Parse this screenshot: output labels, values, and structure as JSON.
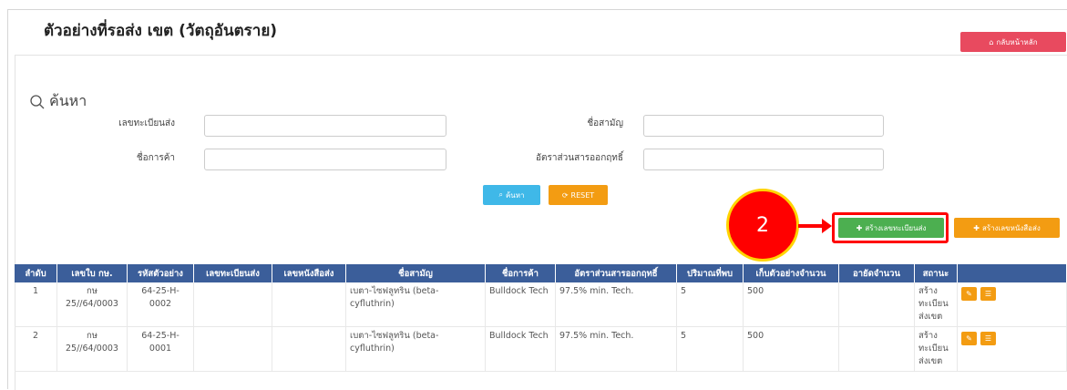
{
  "page": {
    "title": "ตัวอย่างที่รอส่ง เขต (วัตถุอันตราย)",
    "home_button": "กลับหน้าหลัก"
  },
  "search": {
    "heading": "ค้นหา",
    "fields": [
      {
        "label": "เลขทะเบียนส่ง",
        "value": ""
      },
      {
        "label": "ชื่อสามัญ",
        "value": ""
      },
      {
        "label": "ชื่อการค้า",
        "value": ""
      },
      {
        "label": "อัตราส่วนสารออกฤทธิ์",
        "value": ""
      }
    ],
    "search_button": "ค้นหา",
    "reset_button": "RESET"
  },
  "actions": {
    "create_registration": "สร้างเลขทะเบียนส่ง",
    "create_letter": "สร้างเลขหนังสือส่ง"
  },
  "annotation": {
    "step": "2",
    "color": "#ff0000"
  },
  "table": {
    "headers": [
      "ลำดับ",
      "เลขใบ กษ.",
      "รหัสตัวอย่าง",
      "เลขทะเบียนส่ง",
      "เลขหนังสือส่ง",
      "ชื่อสามัญ",
      "ชื่อการค้า",
      "อัตราส่วนสารออกฤทธิ์",
      "ปริมาณที่พบ",
      "เก็บตัวอย่างจำนวน",
      "อายัดจำนวน",
      "สถานะ",
      ""
    ],
    "rows": [
      {
        "no": "1",
        "license": "กษ 25//64/0003",
        "sample": "64-25-H-0002",
        "reg": "",
        "letter": "",
        "common": "เบตา-ไซฟลูทริน (beta-cyfluthrin)",
        "trade": "Bulldock Tech",
        "ratio": "97.5% min. Tech.",
        "found": "5",
        "collected": "500",
        "seized": "",
        "status": "สร้างทะเบียนส่งเขต"
      },
      {
        "no": "2",
        "license": "กษ 25//64/0003",
        "sample": "64-25-H-0001",
        "reg": "",
        "letter": "",
        "common": "เบตา-ไซฟลูทริน (beta-cyfluthrin)",
        "trade": "Bulldock Tech",
        "ratio": "97.5% min. Tech.",
        "found": "5",
        "collected": "500",
        "seized": "",
        "status": "สร้างทะเบียนส่งเขต"
      }
    ]
  },
  "icons": {
    "home": "home-icon",
    "search": "search-icon",
    "reset": "refresh-icon",
    "plus": "plus-icon",
    "edit": "edit-icon",
    "list": "list-icon"
  },
  "colors": {
    "home_button": "#e84a5f",
    "search_button": "#3fb8e8",
    "reset_button": "#f39c12",
    "create_registration": "#4caf50",
    "create_letter": "#f39c12",
    "table_header": "#3b5e9a"
  }
}
